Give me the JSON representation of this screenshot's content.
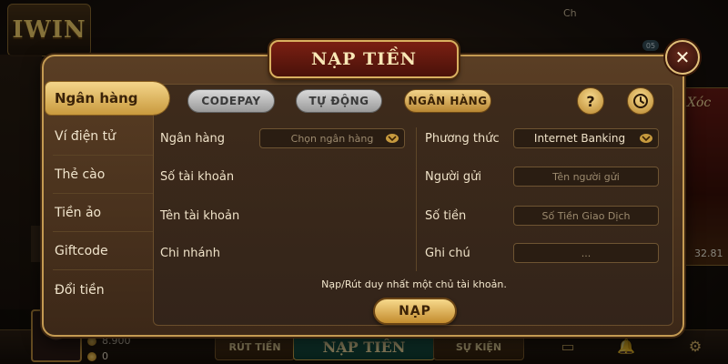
{
  "background": {
    "logo_text": "IWIN",
    "top_text": "Ch",
    "badge": "05",
    "side_card_title": "Xóc",
    "side_card_value": "32.81",
    "balance_coin": "8.900",
    "balance_other": "0",
    "bottom_left_label": "RÚT TIỀN",
    "bottom_center_label": "NẠP TIỀN",
    "bottom_right_label": "SỰ KIỆN"
  },
  "modal": {
    "title": "NẠP TIỀN",
    "close_label": "✕",
    "sidebar": [
      {
        "label": "Ngân hàng",
        "active": true
      },
      {
        "label": "Ví điện tử",
        "active": false
      },
      {
        "label": "Thẻ cào",
        "active": false
      },
      {
        "label": "Tiền ảo",
        "active": false
      },
      {
        "label": "Giftcode",
        "active": false
      },
      {
        "label": "Đổi tiền",
        "active": false
      }
    ],
    "tabs": [
      {
        "label": "CODEPAY",
        "active": false
      },
      {
        "label": "TỰ ĐỘNG",
        "active": false
      },
      {
        "label": "NGÂN HÀNG",
        "active": true
      }
    ],
    "help_label": "?",
    "form": {
      "bank_label": "Ngân hàng",
      "bank_placeholder": "Chọn ngân hàng",
      "account_number_label": "Số tài khoản",
      "account_name_label": "Tên tài khoản",
      "branch_label": "Chi nhánh",
      "method_label": "Phương thức",
      "method_value": "Internet Banking",
      "sender_label": "Người gửi",
      "sender_placeholder": "Tên người gửi",
      "amount_label": "Số tiền",
      "amount_placeholder": "Số Tiền Giao Dịch",
      "note_label": "Ghi chú",
      "note_placeholder": "..."
    },
    "notice": "Nạp/Rút duy nhất một chủ tài khoản.",
    "submit_label": "NẠP"
  },
  "colors": {
    "accent_gold": "#f3d48a",
    "title_red": "#7a1f12",
    "panel_brown": "#3e2b1b"
  }
}
